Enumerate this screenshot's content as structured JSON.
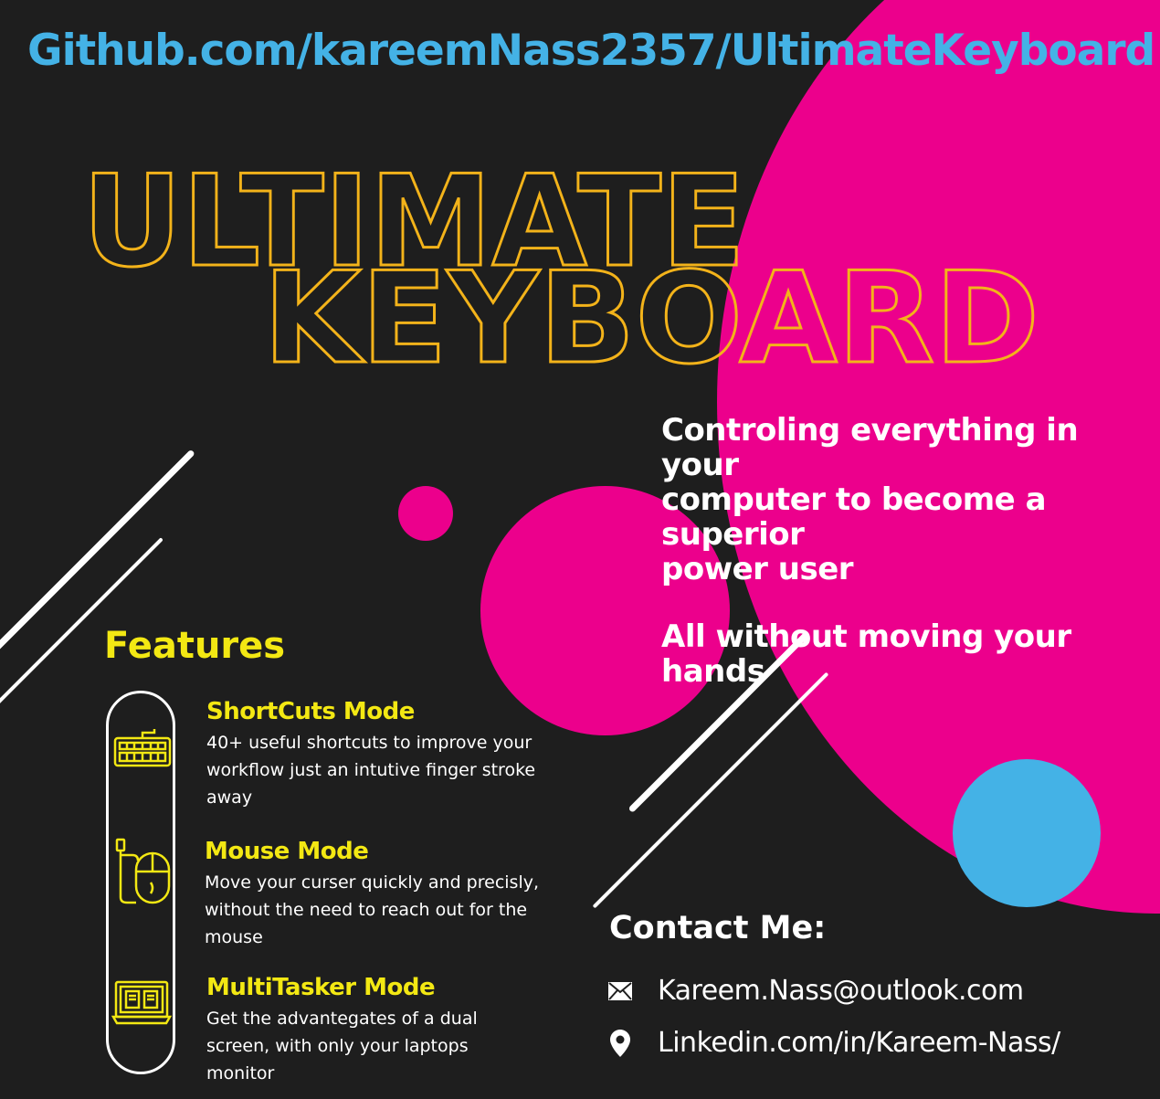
{
  "header": {
    "github_link": "Github.com/kareemNass2357/UltimateKeyboard"
  },
  "title": {
    "line1": "ULTIMATE",
    "line2": "KEYBOARD"
  },
  "tagline": {
    "line1": "Controling everything in your",
    "line2": "computer to become a superior",
    "line3": "power user",
    "line4": "All without moving your hands"
  },
  "features": {
    "heading": "Features",
    "items": [
      {
        "title": "ShortCuts Mode",
        "desc": "40+ useful shortcuts to improve your workflow just an intutive finger stroke away",
        "icon": "keyboard-icon"
      },
      {
        "title": "Mouse Mode",
        "desc": "Move your curser quickly and precisly, without the need to reach out for the mouse",
        "icon": "mouse-icon"
      },
      {
        "title": "MultiTasker Mode",
        "desc": "Get the advantegates of a dual screen, with only your laptops monitor",
        "icon": "laptop-windows-icon"
      }
    ]
  },
  "contact": {
    "heading": "Contact Me:",
    "email": "Kareem.Nass@outlook.com",
    "linkedin": "Linkedin.com/in/Kareem-Nass/",
    "email_icon": "envelope-icon",
    "linkedin_icon": "location-pin-icon"
  },
  "colors": {
    "background": "#1e1e1e",
    "magenta": "#ec008c",
    "cyan": "#44b2e6",
    "title_yellow": "#f3b31a",
    "heading_yellow": "#f3e813",
    "text_white": "#ffffff"
  }
}
